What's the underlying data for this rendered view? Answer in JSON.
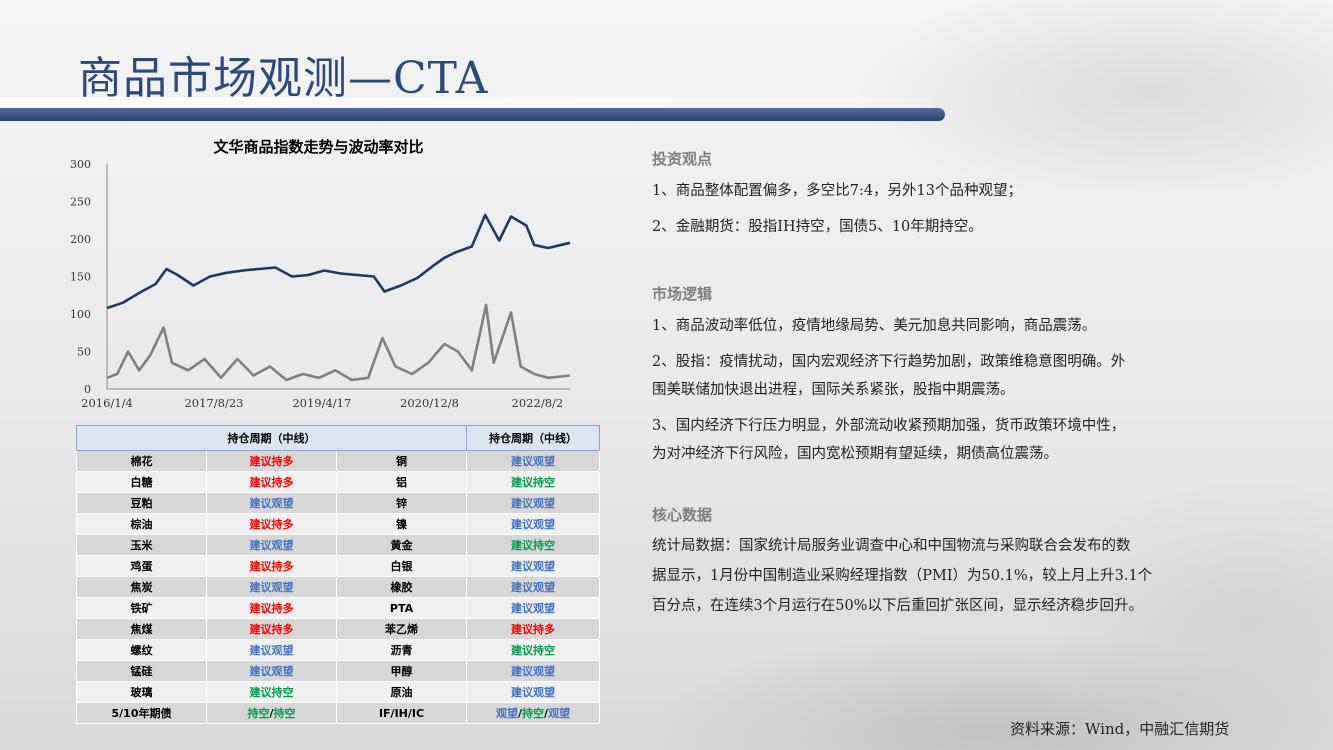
{
  "page": {
    "title": "商品市场观测—CTA",
    "source": "资料来源：Wind，中融汇信期货"
  },
  "chart_data": {
    "type": "line",
    "title": "文华商品指数走势与波动率对比",
    "xlabel": "",
    "ylabel": "",
    "ylim": [
      0,
      300
    ],
    "yticks": [
      0,
      50,
      100,
      150,
      200,
      250,
      300
    ],
    "xticks": [
      "2016/1/4",
      "2017/8/23",
      "2019/4/17",
      "2020/12/8",
      "2022/8/2"
    ],
    "xrange": [
      "2016/1/4",
      "2023/1/31"
    ],
    "grid": false,
    "legend": "none",
    "series": [
      {
        "color": "#1f3a5f",
        "x": [
          "2016/1/4",
          "2016/4/1",
          "2016/7/1",
          "2016/10/1",
          "2016/12/1",
          "2017/2/1",
          "2017/5/1",
          "2017/8/1",
          "2017/11/1",
          "2018/2/1",
          "2018/5/1",
          "2018/8/1",
          "2018/11/1",
          "2019/2/1",
          "2019/5/1",
          "2019/8/1",
          "2019/11/1",
          "2020/2/1",
          "2020/4/1",
          "2020/7/1",
          "2020/10/1",
          "2021/1/1",
          "2021/3/1",
          "2021/5/1",
          "2021/8/1",
          "2021/10/15",
          "2022/1/1",
          "2022/3/8",
          "2022/6/1",
          "2022/7/15",
          "2022/10/1",
          "2023/1/31"
        ],
        "values": [
          108,
          115,
          128,
          140,
          160,
          152,
          138,
          150,
          155,
          158,
          160,
          162,
          150,
          152,
          158,
          154,
          152,
          150,
          130,
          138,
          148,
          165,
          175,
          182,
          190,
          232,
          198,
          230,
          218,
          192,
          188,
          195
        ]
      },
      {
        "color": "#808080",
        "x": [
          "2016/1/4",
          "2016/3/1",
          "2016/5/1",
          "2016/7/1",
          "2016/9/1",
          "2016/11/15",
          "2017/1/1",
          "2017/4/1",
          "2017/7/1",
          "2017/10/1",
          "2018/1/1",
          "2018/4/1",
          "2018/7/1",
          "2018/10/1",
          "2019/1/1",
          "2019/4/1",
          "2019/7/1",
          "2019/10/1",
          "2020/1/1",
          "2020/3/20",
          "2020/6/1",
          "2020/9/1",
          "2020/12/1",
          "2021/3/1",
          "2021/5/15",
          "2021/8/1",
          "2021/10/20",
          "2021/12/1",
          "2022/3/8",
          "2022/5/1",
          "2022/7/15",
          "2022/10/1",
          "2023/1/31"
        ],
        "values": [
          15,
          20,
          50,
          25,
          45,
          82,
          35,
          25,
          40,
          15,
          40,
          18,
          30,
          12,
          20,
          15,
          25,
          12,
          15,
          68,
          30,
          20,
          35,
          60,
          50,
          25,
          112,
          35,
          102,
          30,
          20,
          15,
          18
        ]
      }
    ]
  },
  "holdings": {
    "header_left": "持仓周期（中线）",
    "header_right": "持仓周期（中线）",
    "rows": [
      {
        "name1": "棉花",
        "action1": "建议持多",
        "c1": "red",
        "name2": "铜",
        "action2": "建议观望",
        "c2": "blue"
      },
      {
        "name1": "白糖",
        "action1": "建议持多",
        "c1": "red",
        "name2": "铝",
        "action2": "建议持空",
        "c2": "green"
      },
      {
        "name1": "豆粕",
        "action1": "建议观望",
        "c1": "blue",
        "name2": "锌",
        "action2": "建议观望",
        "c2": "blue"
      },
      {
        "name1": "棕油",
        "action1": "建议持多",
        "c1": "red",
        "name2": "镍",
        "action2": "建议观望",
        "c2": "blue"
      },
      {
        "name1": "玉米",
        "action1": "建议观望",
        "c1": "blue",
        "name2": "黄金",
        "action2": "建议持空",
        "c2": "green"
      },
      {
        "name1": "鸡蛋",
        "action1": "建议持多",
        "c1": "red",
        "name2": "白银",
        "action2": "建议观望",
        "c2": "blue"
      },
      {
        "name1": "焦炭",
        "action1": "建议观望",
        "c1": "blue",
        "name2": "橡胶",
        "action2": "建议观望",
        "c2": "blue"
      },
      {
        "name1": "铁矿",
        "action1": "建议持多",
        "c1": "red",
        "name2": "PTA",
        "action2": "建议观望",
        "c2": "blue"
      },
      {
        "name1": "焦煤",
        "action1": "建议持多",
        "c1": "red",
        "name2": "苯乙烯",
        "action2": "建议持多",
        "c2": "red"
      },
      {
        "name1": "螺纹",
        "action1": "建议观望",
        "c1": "blue",
        "name2": "沥青",
        "action2": "建议持空",
        "c2": "green"
      },
      {
        "name1": "锰硅",
        "action1": "建议观望",
        "c1": "blue",
        "name2": "甲醇",
        "action2": "建议观望",
        "c2": "blue"
      },
      {
        "name1": "玻璃",
        "action1": "建议持空",
        "c1": "green",
        "name2": "原油",
        "action2": "建议观望",
        "c2": "blue"
      }
    ],
    "last_row": {
      "name1": "5/10年期债",
      "action1_a": "持空",
      "action1_sep": "/",
      "action1_b": "持空",
      "name2": "IF/IH/IC",
      "action2_a": "观望",
      "action2_sep1": "/",
      "action2_b": "持空",
      "action2_sep2": "/",
      "action2_c": "观望"
    }
  },
  "sections": {
    "view": {
      "title": "投资观点",
      "lines": [
        "1、商品整体配置偏多，多空比7:4，另外13个品种观望；",
        "2、金融期货：股指IH持空，国债5、10年期持空。"
      ]
    },
    "logic": {
      "title": "市场逻辑",
      "lines": [
        "1、商品波动率低位，疫情地缘局势、美元加息共同影响，商品震荡。",
        "2、股指：疫情扰动，国内宏观经济下行趋势加剧，政策维稳意图明确。外",
        "围美联储加快退出进程，国际关系紧张，股指中期震荡。",
        "3、国内经济下行压力明显，外部流动收紧预期加强，货币政策环境中性，",
        "为对冲经济下行风险，国内宽松预期有望延续，期债高位震荡。"
      ]
    },
    "core": {
      "title": "核心数据",
      "lines": [
        "统计局数据：国家统计局服务业调查中心和中国物流与采购联合会发布的数",
        "据显示，1月份中国制造业采购经理指数（PMI）为50.1%，较上月上升3.1个",
        "百分点，在连续3个月运行在50%以下后重回扩张区间，显示经济稳步回升。"
      ]
    }
  }
}
